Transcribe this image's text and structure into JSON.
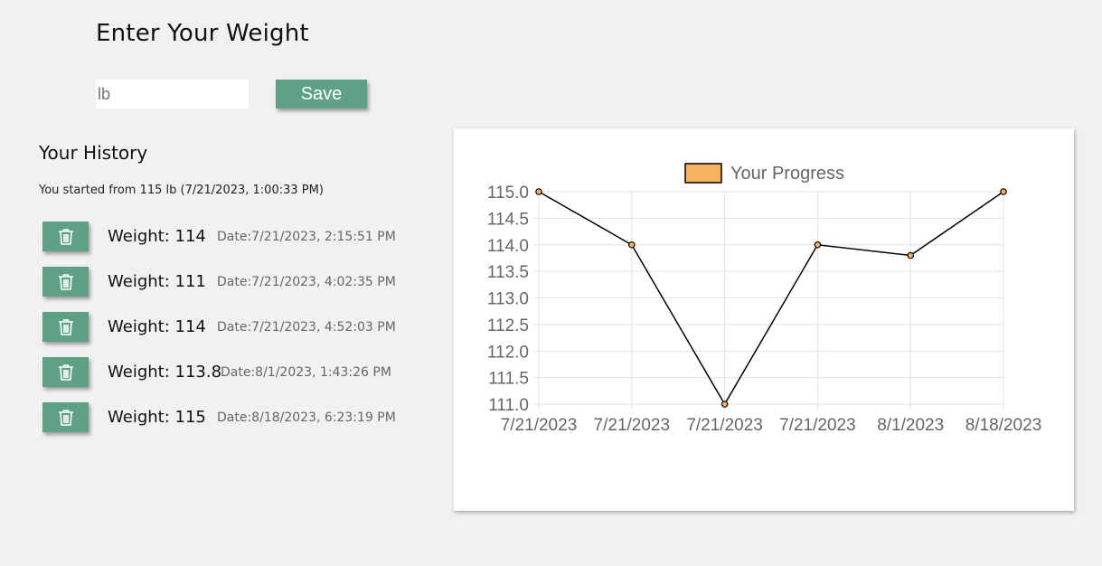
{
  "form": {
    "title": "Enter Your Weight",
    "input_placeholder": "lb",
    "input_value": "",
    "save_label": "Save"
  },
  "history": {
    "title": "Your History",
    "started_text": "You started from 115 lb (7/21/2023, 1:00:33 PM)",
    "entries": [
      {
        "weight": "Weight: 114",
        "date": "Date:7/21/2023, 2:15:51 PM"
      },
      {
        "weight": "Weight: 111",
        "date": "Date:7/21/2023, 4:02:35 PM"
      },
      {
        "weight": "Weight: 114",
        "date": "Date:7/21/2023, 4:52:03 PM"
      },
      {
        "weight": "Weight: 113.8",
        "date": "Date:8/1/2023, 1:43:26 PM"
      },
      {
        "weight": "Weight: 115",
        "date": "Date:8/18/2023, 6:23:19 PM"
      }
    ],
    "delete_icon": "trash-icon"
  },
  "colors": {
    "accent": "#5fa185",
    "legend_fill": "#f6b35f",
    "line": "#000000"
  },
  "chart_data": {
    "type": "line",
    "categories": [
      "7/21/2023",
      "7/21/2023",
      "7/21/2023",
      "7/21/2023",
      "8/1/2023",
      "8/18/2023"
    ],
    "series": [
      {
        "name": "Your Progress",
        "values": [
          115,
          114,
          111,
          114,
          113.8,
          115
        ]
      }
    ],
    "ylim": [
      111,
      115
    ],
    "yticks": [
      "115.0",
      "114.5",
      "114.0",
      "113.5",
      "113.0",
      "112.5",
      "112.0",
      "111.5",
      "111.0"
    ],
    "grid": true,
    "legend": "top"
  }
}
